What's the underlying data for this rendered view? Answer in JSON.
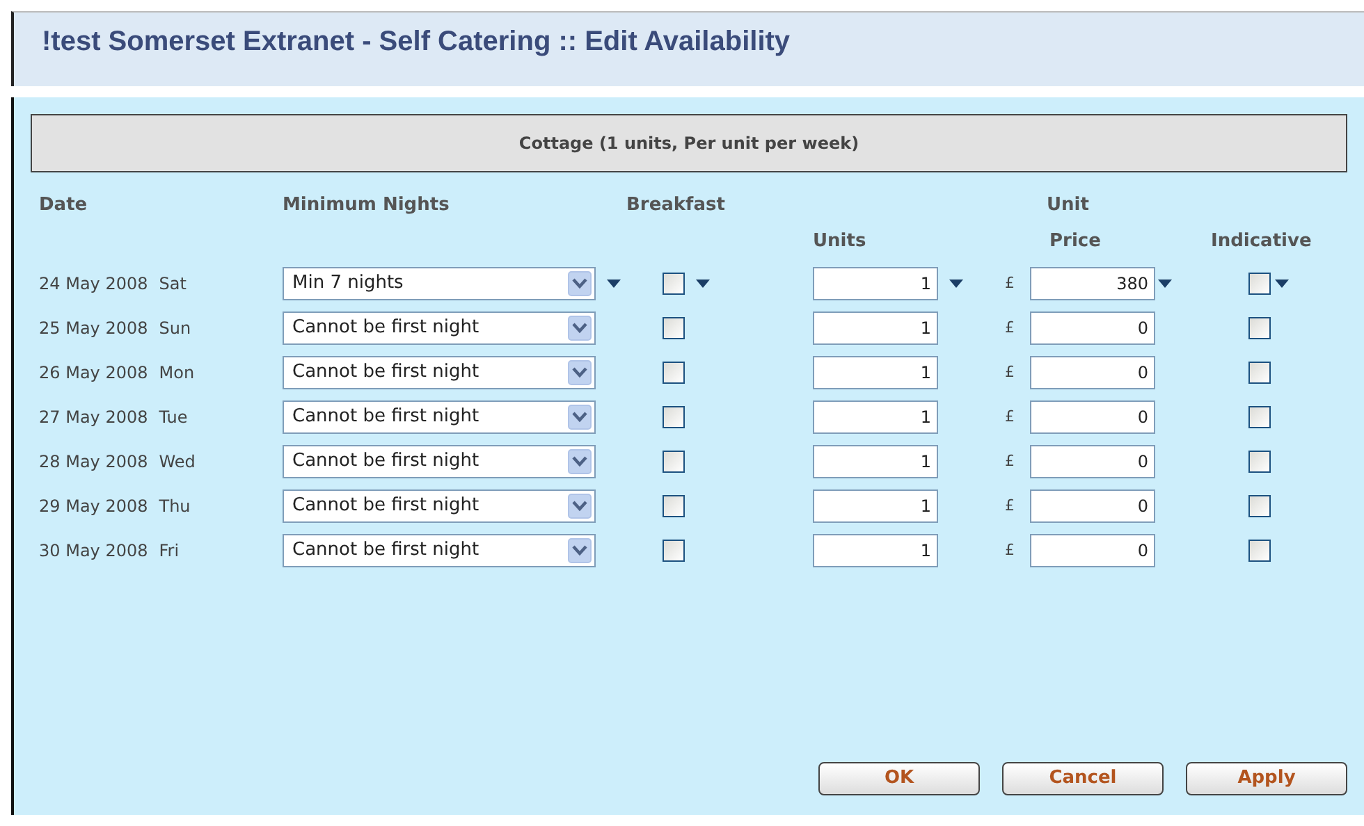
{
  "window": {
    "title": "!test Somerset Extranet - Self Catering :: Edit Availability"
  },
  "unit_header": "Cottage (1 units, Per unit per week)",
  "columns": {
    "date": "Date",
    "min_nights": "Minimum Nights",
    "breakfast": "Breakfast",
    "unit_price_top": "Unit",
    "units": "Units",
    "price": "Price",
    "indicative": "Indicative"
  },
  "rows": [
    {
      "date": "24 May 2008",
      "day": "Sat",
      "min_nights": "Min 7 nights",
      "breakfast": false,
      "units": "1",
      "currency": "£",
      "price": "380",
      "indicative": false,
      "fill_down": true
    },
    {
      "date": "25 May 2008",
      "day": "Sun",
      "min_nights": "Cannot be first night",
      "breakfast": false,
      "units": "1",
      "currency": "£",
      "price": "0",
      "indicative": false,
      "fill_down": false
    },
    {
      "date": "26 May 2008",
      "day": "Mon",
      "min_nights": "Cannot be first night",
      "breakfast": false,
      "units": "1",
      "currency": "£",
      "price": "0",
      "indicative": false,
      "fill_down": false
    },
    {
      "date": "27 May 2008",
      "day": "Tue",
      "min_nights": "Cannot be first night",
      "breakfast": false,
      "units": "1",
      "currency": "£",
      "price": "0",
      "indicative": false,
      "fill_down": false
    },
    {
      "date": "28 May 2008",
      "day": "Wed",
      "min_nights": "Cannot be first night",
      "breakfast": false,
      "units": "1",
      "currency": "£",
      "price": "0",
      "indicative": false,
      "fill_down": false
    },
    {
      "date": "29 May 2008",
      "day": "Thu",
      "min_nights": "Cannot be first night",
      "breakfast": false,
      "units": "1",
      "currency": "£",
      "price": "0",
      "indicative": false,
      "fill_down": false
    },
    {
      "date": "30 May 2008",
      "day": "Fri",
      "min_nights": "Cannot be first night",
      "breakfast": false,
      "units": "1",
      "currency": "£",
      "price": "0",
      "indicative": false,
      "fill_down": false
    }
  ],
  "buttons": [
    {
      "label": "OK"
    },
    {
      "label": "Cancel"
    },
    {
      "label": "Apply"
    }
  ]
}
